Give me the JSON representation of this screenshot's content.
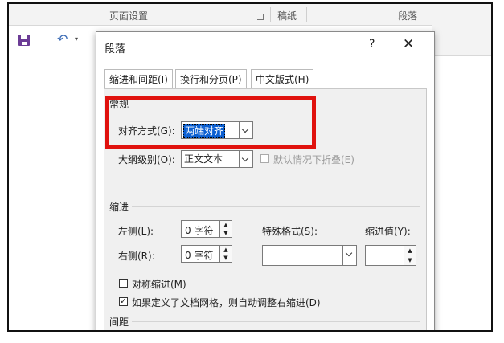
{
  "ribbon": {
    "page_setup": "页面设置",
    "draft": "稿纸",
    "paragraph": "段落"
  },
  "dialog": {
    "title": "段落",
    "help": "?",
    "close": "✕",
    "tabs": [
      {
        "label": "缩进和间距(I)"
      },
      {
        "label": "换行和分页(P)"
      },
      {
        "label": "中文版式(H)"
      }
    ],
    "general": {
      "heading": "常规",
      "alignment_label": "对齐方式(G):",
      "alignment_value": "两端对齐",
      "outline_label": "大纲级别(O):",
      "outline_value": "正文文本",
      "collapse_label": "默认情况下折叠(E)"
    },
    "indent": {
      "heading": "缩进",
      "left_label": "左侧(L):",
      "left_value": "0 字符",
      "right_label": "右侧(R):",
      "right_value": "0 字符",
      "special_label": "特殊格式(S):",
      "special_value": "",
      "indent_value_label": "缩进值(Y):",
      "indent_value": "",
      "mirror_label": "对称缩进(M)",
      "auto_adjust_label": "如果定义了文档网格，则自动调整右缩进(D)"
    },
    "spacing": {
      "heading": "间距"
    }
  },
  "colors": {
    "highlight_box": "#e0120e",
    "selection": "#0b5fd1",
    "save_icon": "#6c3c96",
    "undo_icon": "#3b6bb5"
  }
}
